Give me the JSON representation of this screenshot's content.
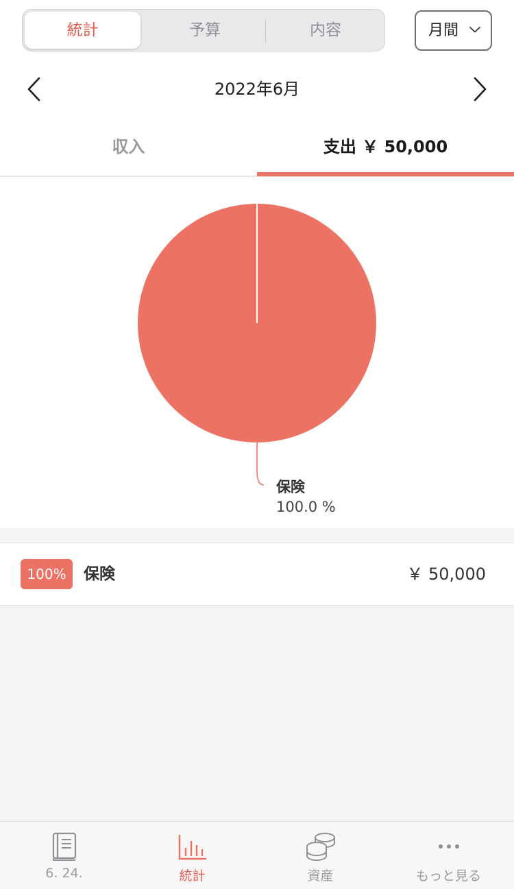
{
  "colors": {
    "accent": "#ec7364",
    "accent_text": "#e65d50",
    "muted": "#9a9a9e"
  },
  "segment": {
    "tabs": [
      "統計",
      "予算",
      "内容"
    ],
    "active_index": 0
  },
  "period_selector": {
    "label": "月間",
    "icon": "chevron-down-icon"
  },
  "month_nav": {
    "prev_icon": "chevron-left-icon",
    "title": "2022年6月",
    "next_icon": "chevron-right-icon"
  },
  "type_tabs": {
    "income_label": "収入",
    "expense_label": "支出 ￥ 50,000",
    "active": "expense"
  },
  "chart_data": {
    "type": "pie",
    "slices": [
      {
        "label": "保険",
        "value": 100.0,
        "percent_text": "100.0 %",
        "color": "#ec7364"
      }
    ]
  },
  "category_list": [
    {
      "badge": "100%",
      "name": "保険",
      "amount": "￥ 50,000"
    }
  ],
  "bottom_nav": {
    "items": [
      {
        "label": "6. 24.",
        "icon": "book-icon"
      },
      {
        "label": "統計",
        "icon": "bar-chart-icon",
        "active": true
      },
      {
        "label": "資産",
        "icon": "coins-icon"
      },
      {
        "label": "もっと見る",
        "icon": "more-dots-icon"
      }
    ]
  }
}
